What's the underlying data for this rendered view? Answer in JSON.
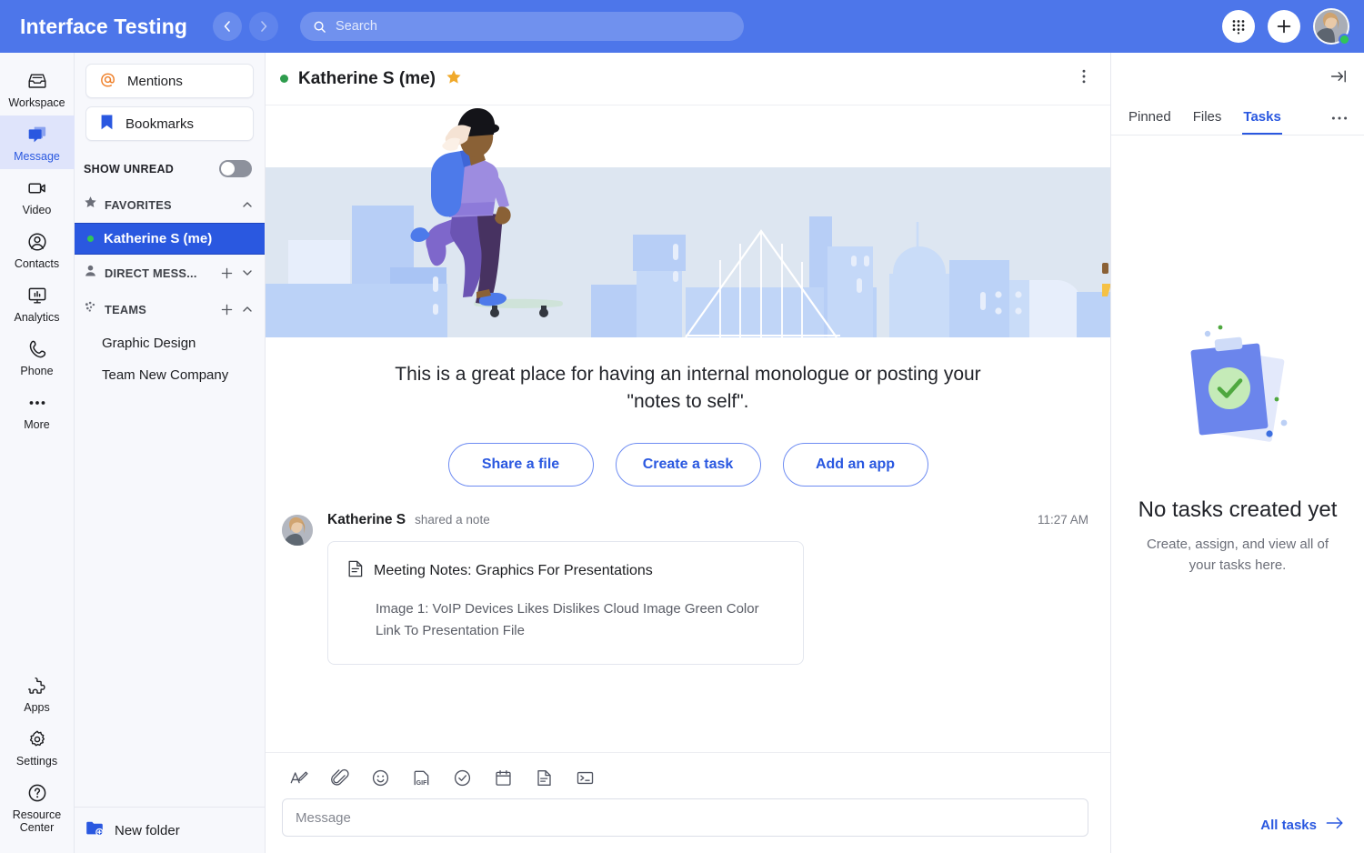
{
  "topbar": {
    "app_title": "Interface Testing",
    "back_icon": "chevron-left-icon",
    "forward_icon": "chevron-right-icon",
    "search": {
      "placeholder": "Search",
      "value": "",
      "icon": "search-icon"
    },
    "dialpad_icon": "dialpad-icon",
    "add_icon": "plus-icon",
    "avatar_label": "user-avatar",
    "status": "online",
    "bg_color": "#4d76ea"
  },
  "rail": {
    "items": [
      {
        "label": "Workspace",
        "icon": "inbox-icon",
        "active": false
      },
      {
        "label": "Message",
        "icon": "message-bubbles-icon",
        "active": true
      },
      {
        "label": "Video",
        "icon": "video-camera-icon",
        "active": false
      },
      {
        "label": "Contacts",
        "icon": "person-circle-icon",
        "active": false
      },
      {
        "label": "Analytics",
        "icon": "monitor-chart-icon",
        "active": false
      },
      {
        "label": "Phone",
        "icon": "phone-icon",
        "active": false
      },
      {
        "label": "More",
        "icon": "ellipsis-icon",
        "active": false
      }
    ],
    "bottom_items": [
      {
        "label": "Apps",
        "icon": "puzzle-piece-icon"
      },
      {
        "label": "Settings",
        "icon": "gear-icon"
      },
      {
        "label": "Resource Center",
        "icon": "question-circle-icon"
      }
    ],
    "active_color": "#2a58e0",
    "active_bg": "#dfe4fb"
  },
  "channel_list": {
    "mentions": {
      "label": "Mentions",
      "icon": "at-sign-icon"
    },
    "bookmarks": {
      "label": "Bookmarks",
      "icon": "bookmark-icon"
    },
    "show_unread": {
      "label": "SHOW UNREAD",
      "enabled": false
    },
    "groups": [
      {
        "label": "FAVORITES",
        "icon": "star-icon",
        "expanded": true,
        "has_add": false,
        "chevron": "chevron-up-icon",
        "items": [
          {
            "label": "Katherine S (me)",
            "selected": true,
            "presence": "online"
          }
        ]
      },
      {
        "label": "DIRECT MESS...",
        "icon": "person-icon",
        "expanded": false,
        "has_add": true,
        "chevron": "chevron-down-icon",
        "items": []
      },
      {
        "label": "TEAMS",
        "icon": "team-dots-icon",
        "expanded": true,
        "has_add": true,
        "chevron": "chevron-up-icon",
        "items": [
          {
            "label": "Graphic Design",
            "selected": false
          },
          {
            "label": "Team New Company",
            "selected": false
          }
        ]
      }
    ],
    "new_folder": {
      "label": "New folder",
      "icon": "folder-plus-icon"
    }
  },
  "main": {
    "header": {
      "title": "Katherine S (me)",
      "presence": "online",
      "starred": true,
      "star_icon": "star-filled-icon",
      "menu_icon": "kebab-menu-icon"
    },
    "hero": {
      "illustration": "skateboarder-city-skyline-illustration"
    },
    "intro_text": "This is a great place for having an internal monologue or posting your \"notes to self\".",
    "cta_buttons": [
      {
        "label": "Share a file"
      },
      {
        "label": "Create a task"
      },
      {
        "label": "Add an app"
      }
    ],
    "message": {
      "author": "Katherine S",
      "action": "shared a note",
      "time": "11:27 AM",
      "avatar_label": "message-avatar",
      "note": {
        "icon": "note-document-icon",
        "title": "Meeting Notes: Graphics For Presentations",
        "body": "Image 1: VoIP Devices Likes Dislikes Cloud Image Green Color Link To Presentation File"
      }
    },
    "composer": {
      "tools": [
        {
          "name": "text-format-icon",
          "title": "Format text"
        },
        {
          "name": "paperclip-icon",
          "title": "Attach file"
        },
        {
          "name": "emoji-icon",
          "title": "Emoji"
        },
        {
          "name": "gif-icon",
          "title": "GIF"
        },
        {
          "name": "task-check-icon",
          "title": "Create task"
        },
        {
          "name": "calendar-icon",
          "title": "Event"
        },
        {
          "name": "note-icon",
          "title": "Note"
        },
        {
          "name": "code-command-icon",
          "title": "Command"
        }
      ],
      "input": {
        "placeholder": "Message",
        "value": ""
      }
    }
  },
  "right_panel": {
    "collapse_icon": "collapse-right-icon",
    "tabs": [
      {
        "label": "Pinned",
        "active": false
      },
      {
        "label": "Files",
        "active": false
      },
      {
        "label": "Tasks",
        "active": true
      }
    ],
    "more_icon": "ellipsis-icon",
    "empty": {
      "illustration": "clipboard-check-illustration",
      "title": "No tasks created yet",
      "subtitle": "Create, assign, and view all of your tasks here."
    },
    "footer_link": {
      "label": "All tasks",
      "icon": "arrow-right-icon"
    },
    "accent_color": "#2a58e0"
  }
}
